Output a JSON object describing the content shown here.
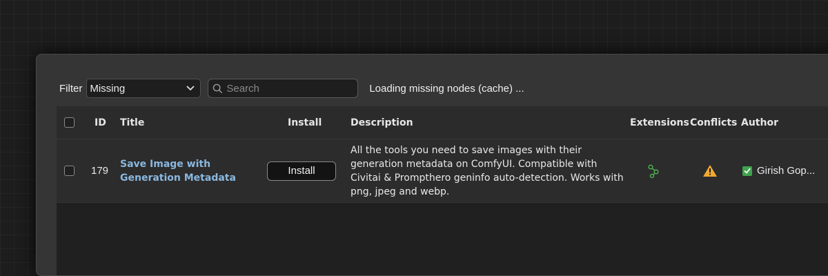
{
  "filter": {
    "label": "Filter",
    "selected": "Missing"
  },
  "search": {
    "placeholder": "Search"
  },
  "status": "Loading missing nodes (cache) ...",
  "table": {
    "headers": {
      "id": "ID",
      "title": "Title",
      "install": "Install",
      "description": "Description",
      "extensions": "Extensions",
      "conflicts": "Conflicts",
      "author": "Author"
    },
    "rows": [
      {
        "id": "179",
        "title": "Save Image with Generation Metadata",
        "install_label": "Install",
        "description": "All the tools you need to save images with their generation metadata on ComfyUI. Compatible with Civitai & Prompthero geninfo auto-detection. Works with png, jpeg and webp.",
        "extensions_icon": "link-nodes-icon",
        "conflicts_icon": "warning-icon",
        "author": "Girish Gop..."
      }
    ]
  },
  "colors": {
    "title_link": "#8ab8e0",
    "extensions_icon": "#4caf50",
    "warning": "#f0a830",
    "verified": "#3fa34d"
  }
}
